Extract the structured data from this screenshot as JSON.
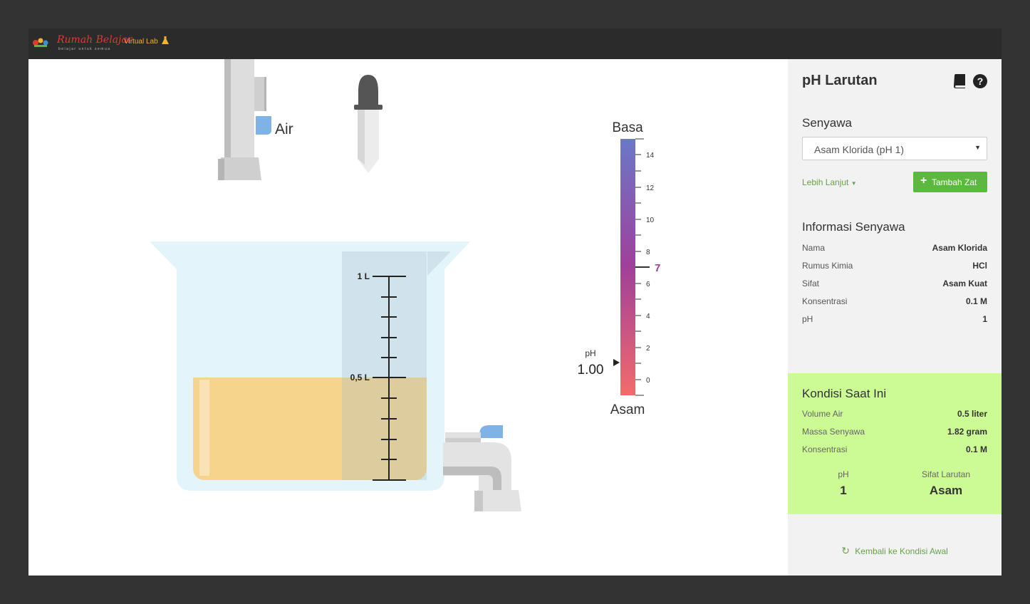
{
  "header": {
    "brand": "Rumah Belajar",
    "tagline": "belajar untuk semua",
    "product": "Virtual Lab"
  },
  "stage": {
    "water_label": "Air",
    "beaker_mark_full": "1 L",
    "beaker_mark_half": "0,5 L",
    "scale_top": "Basa",
    "scale_bottom": "Asam",
    "ticks": [
      "14",
      "12",
      "10",
      "8",
      "6",
      "4",
      "2",
      "0"
    ],
    "neutral_mark": "7",
    "ph_caption": "pH",
    "ph_value": "1.00",
    "liquid_color": "#f6d48c",
    "liquid_level_fraction": 0.5
  },
  "sidebar": {
    "title": "pH Larutan",
    "compound_label": "Senyawa",
    "compound_selected": "Asam Klorida (pH 1)",
    "more_link": "Lebih Lanjut",
    "add_button": "Tambah Zat",
    "info_title": "Informasi Senyawa",
    "info": [
      {
        "key": "Nama",
        "value": "Asam Klorida"
      },
      {
        "key": "Rumus Kimia",
        "value": "HCl"
      },
      {
        "key": "Sifat",
        "value": "Asam Kuat"
      },
      {
        "key": "Konsentrasi",
        "value": "0.1 M"
      },
      {
        "key": "pH",
        "value": "1"
      }
    ],
    "condition": {
      "title": "Kondisi Saat Ini",
      "rows": [
        {
          "key": "Volume Air",
          "value": "0.5 liter"
        },
        {
          "key": "Massa Senyawa",
          "value": "1.82 gram"
        },
        {
          "key": "Konsentrasi",
          "value": "0.1 M"
        }
      ],
      "ph_label": "pH",
      "ph_value": "1",
      "nature_label": "Sifat Larutan",
      "nature_value": "Asam"
    },
    "reset_link": "Kembali ke Kondisi Awal"
  },
  "colors": {
    "accent_green": "#5cb83f",
    "link_green": "#68a04c",
    "condition_bg": "#ccfa95",
    "scale_top": "#6b78c8",
    "scale_mid": "#a0409a",
    "scale_bottom": "#f26b6b"
  }
}
